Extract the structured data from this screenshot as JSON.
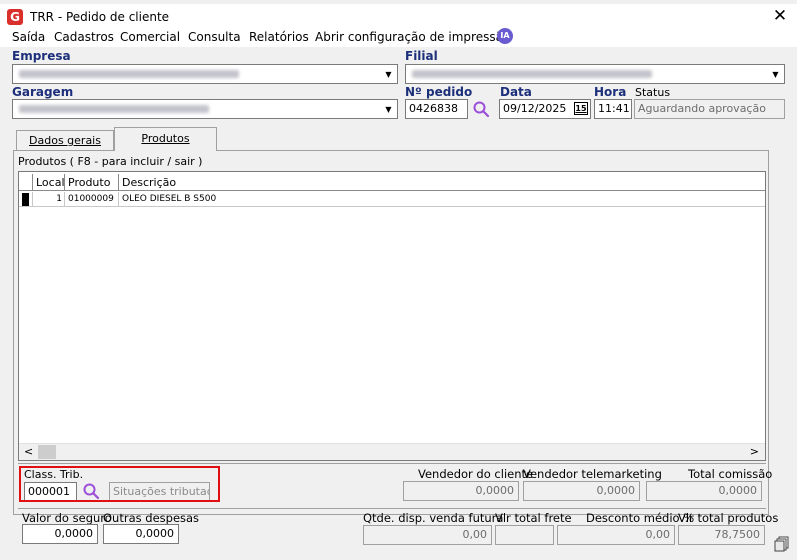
{
  "window": {
    "title": "TRR - Pedido de cliente",
    "logo_letter": "G",
    "close": "✕"
  },
  "menu": {
    "items": [
      "Saída",
      "Cadastros",
      "Comercial",
      "Consulta",
      "Relatórios",
      "Abrir configuração de impressão"
    ],
    "ia_label": "IA"
  },
  "header": {
    "empresa_label": "Empresa",
    "filial_label": "Filial",
    "garagem_label": "Garagem",
    "pedido_label": "Nº pedido",
    "pedido_value": "0426838",
    "data_label": "Data",
    "data_value": "09/12/2025",
    "calendar_label": "15",
    "hora_label": "Hora",
    "hora_value": "11:41",
    "status_label": "Status",
    "status_value": "Aguardando aprovação"
  },
  "tabs": [
    {
      "label": "Dados gerais",
      "active": false
    },
    {
      "label": "Produtos",
      "active": true
    }
  ],
  "produtos": {
    "caption": "Produtos ( F8 - para incluir / sair )",
    "columns": [
      "Local",
      "Produto",
      "Descrição"
    ],
    "rows": [
      {
        "local": "1",
        "produto": "01000009",
        "descricao": "OLEO DIESEL B S500"
      }
    ]
  },
  "class_trib": {
    "label": "Class. Trib.",
    "value": "000001",
    "placeholder": "Situações tributadas"
  },
  "vendedor_cliente": {
    "label": "Vendedor do cliente",
    "value": "0,0000"
  },
  "vendedor_tele": {
    "label": "Vendedor telemarketing",
    "value": "0,0000"
  },
  "total_comissao": {
    "label": "Total comissão",
    "value": "0,0000"
  },
  "valor_seguro": {
    "label": "Valor do seguro",
    "value": "0,0000"
  },
  "outras_despesas": {
    "label": "Outras despesas",
    "value": "0,0000"
  },
  "qtde_disp": {
    "label": "Qtde. disp. venda futura",
    "value": "0,00"
  },
  "vlr_frete": {
    "label": "Vlr total frete",
    "value": ""
  },
  "desconto_medio": {
    "label": "Desconto médio %",
    "value": "0,00"
  },
  "vlr_total_produtos": {
    "label": "Vlr total produtos",
    "value": "78,7500"
  },
  "colors": {
    "label_blue": "#1c2f7a",
    "highlight_red": "#e01010",
    "search_purple": "#9b4fd8"
  }
}
